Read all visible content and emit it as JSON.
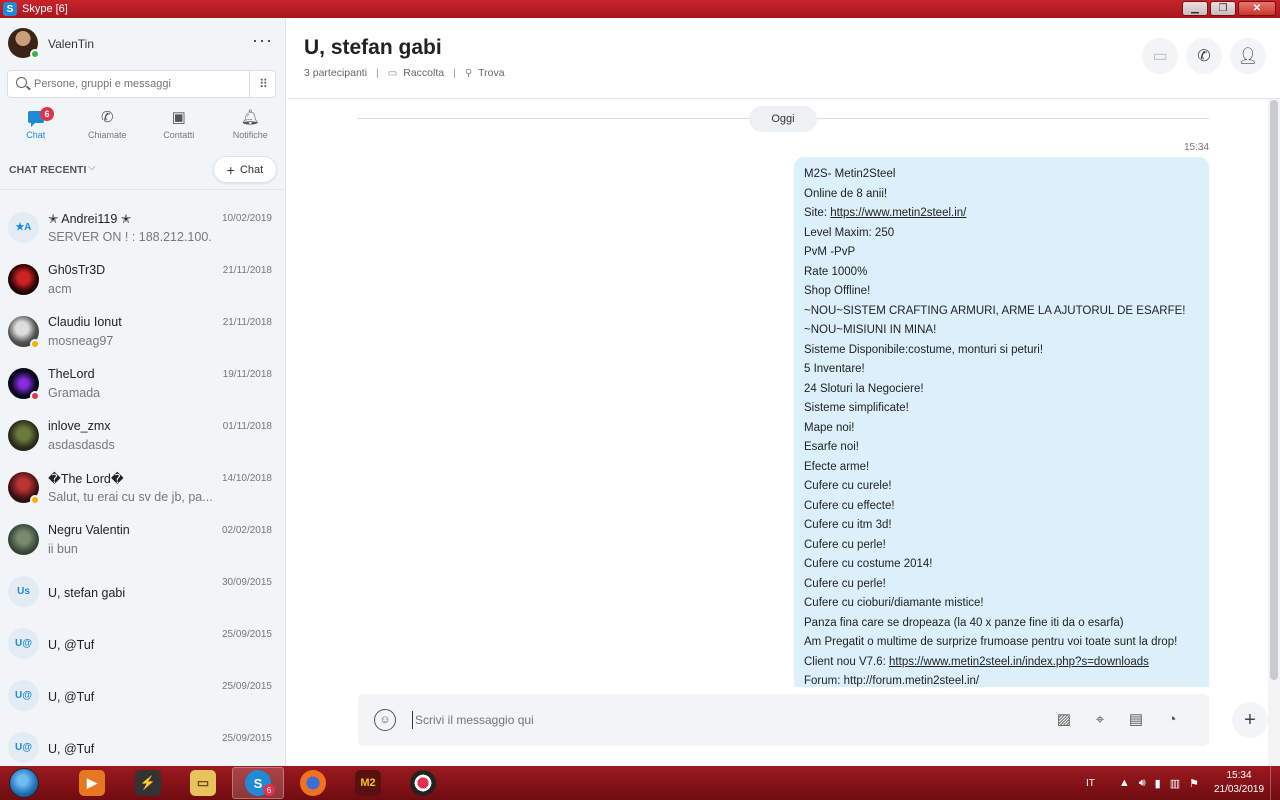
{
  "window": {
    "title": "Skype [6]",
    "app_icon": "S",
    "minimize": "▁",
    "maximize": "❐",
    "close": "✕"
  },
  "profile": {
    "name": "ValenTin",
    "status_color": "#3ab54a",
    "more": "···"
  },
  "search": {
    "placeholder": "Persone, gruppi e messaggi",
    "dialpad_icon": "⠿"
  },
  "nav": {
    "tabs": [
      {
        "label": "Chat",
        "icon": "chat-icon",
        "badge": "6",
        "active": true
      },
      {
        "label": "Chiamate",
        "icon": "phone-icon"
      },
      {
        "label": "Contatti",
        "icon": "contacts-icon"
      },
      {
        "label": "Notifiche",
        "icon": "bell-icon"
      }
    ]
  },
  "recent": {
    "label": "CHAT RECENTI",
    "new_chat_label": "Chat",
    "chevron": "⌵",
    "plus": "+"
  },
  "chats": [
    {
      "name": "✭ Andrei119 ✭",
      "date": "10/02/2019",
      "preview": "SERVER ON ! : 188.212.100.",
      "initials": "✭A"
    },
    {
      "name": "Gh0sTr3D",
      "date": "21/11/2018",
      "preview": "acm"
    },
    {
      "name": "Claudiu Ionut",
      "date": "21/11/2018",
      "preview": "mosneag97",
      "status": "away"
    },
    {
      "name": "TheLord",
      "date": "19/11/2018",
      "preview": "Gramada",
      "status": "busy"
    },
    {
      "name": "inlove_zmx",
      "date": "01/11/2018",
      "preview": "asdasdasds"
    },
    {
      "name": "�The Lord�",
      "date": "14/10/2018",
      "preview": "Salut, tu erai cu sv de jb, pa...",
      "status": "away"
    },
    {
      "name": "Negru Valentin",
      "date": "02/02/2018",
      "preview": "ii bun"
    },
    {
      "name": "U, stefan gabi",
      "date": "30/09/2015",
      "preview": "",
      "initials": "Us"
    },
    {
      "name": "U, @Tuf",
      "date": "25/09/2015",
      "preview": "",
      "initials": "U@"
    },
    {
      "name": "U, @Tuf",
      "date": "25/09/2015",
      "preview": "",
      "initials": "U@"
    },
    {
      "name": "U, @Tuf",
      "date": "25/09/2015",
      "preview": "",
      "initials": "U@"
    }
  ],
  "conversation": {
    "title": "U, stefan gabi",
    "participants": "3 partecipanti",
    "gallery": "Raccolta",
    "find": "Trova",
    "day_label": "Oggi",
    "time": "15:34",
    "message_lines": [
      "M2S- Metin2Steel",
      "Online de 8 anii!",
      "Site: ",
      "Level Maxim: 250",
      "PvM -PvP",
      "Rate 1000%",
      "Shop Offline!",
      "~NOU~SISTEM CRAFTING ARMURI, ARME LA AJUTORUL DE ESARFE!",
      "~NOU~MISIUNI IN MINA!",
      "Sisteme Disponibile:costume, monturi si peturi!",
      "5 Inventare!",
      "24 Sloturi la Negociere!",
      "Sisteme simplificate!",
      "Mape noi!",
      "Esarfe noi!",
      "Efecte arme!",
      "Cufere cu curele!",
      "Cufere cu effecte!",
      "Cufere cu itm 3d!",
      "Cufere cu perle!",
      "Cufere cu costume 2014!",
      "Cufere cu perle!",
      "Cufere cu cioburi/diamante mistice!",
      "Panza fina care se dropeaza (la 40 x panze fine iti da o esarfa)",
      "Am Pregatit o multime de surprize frumoase pentru voi toate sunt la drop!",
      "Client nou V7.6: ",
      "Forum: http://forum.metin2steel.in/"
    ],
    "site_link": "https://www.metin2steel.in/",
    "client_link": "https://www.metin2steel.in/index.php?s=downloads",
    "composer_placeholder": "Scrivi il messaggio qui"
  },
  "taskbar": {
    "skype_badge": "6",
    "language": "IT",
    "time": "15:34",
    "date": "21/03/2019"
  },
  "colors": {
    "accent": "#1f8ad8",
    "bubble": "#dcf0fb",
    "taskbar": "#8c1419"
  }
}
